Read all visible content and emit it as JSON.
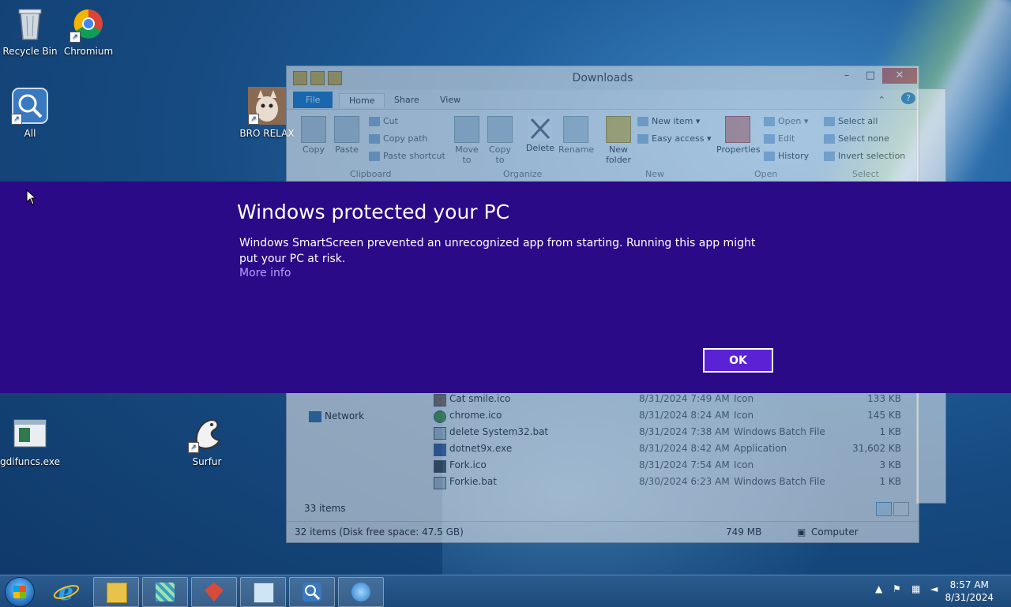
{
  "desktop": {
    "icons": [
      {
        "label": "Recycle Bin"
      },
      {
        "label": "Chromium"
      },
      {
        "label": "All"
      },
      {
        "label": "BRO RELAX"
      },
      {
        "label": "gdifuncs.exe"
      },
      {
        "label": "Surfur"
      }
    ]
  },
  "explorer": {
    "title": "Downloads",
    "tabs": [
      "File",
      "Home",
      "Share",
      "View"
    ],
    "ribbon": {
      "clipboard": {
        "copy": "Copy",
        "paste": "Paste",
        "cut": "Cut",
        "copy_path": "Copy path",
        "paste_shortcut": "Paste shortcut",
        "group": "Clipboard"
      },
      "organize": {
        "move_to": "Move to",
        "copy_to": "Copy to",
        "delete": "Delete",
        "rename": "Rename",
        "group": "Organize"
      },
      "new": {
        "new_folder": "New folder",
        "new_item": "New item",
        "easy_access": "Easy access",
        "group": "New"
      },
      "open": {
        "properties": "Properties",
        "open": "Open",
        "edit": "Edit",
        "history": "History",
        "group": "Open"
      },
      "select": {
        "select_all": "Select all",
        "select_none": "Select none",
        "invert": "Invert selection",
        "group": "Select"
      }
    },
    "nav_network": "Network",
    "files": [
      {
        "name": "Cat smile.ico",
        "date": "8/31/2024 7:49 AM",
        "type": "Icon",
        "size": "133 KB"
      },
      {
        "name": "chrome.ico",
        "date": "8/31/2024 8:24 AM",
        "type": "Icon",
        "size": "145 KB"
      },
      {
        "name": "delete System32.bat",
        "date": "8/31/2024 7:38 AM",
        "type": "Windows Batch File",
        "size": "1 KB"
      },
      {
        "name": "dotnet9x.exe",
        "date": "8/31/2024 8:42 AM",
        "type": "Application",
        "size": "31,602 KB"
      },
      {
        "name": "Fork.ico",
        "date": "8/31/2024 7:54 AM",
        "type": "Icon",
        "size": "3 KB"
      },
      {
        "name": "Forkie.bat",
        "date": "8/30/2024 6:23 AM",
        "type": "Windows Batch File",
        "size": "1 KB"
      }
    ],
    "item_count": "33 items",
    "status_left": "32 items (Disk free space: 47.5 GB)",
    "status_size": "749 MB",
    "status_location": "Computer"
  },
  "smartscreen": {
    "title": "Windows protected your PC",
    "message": "Windows SmartScreen prevented an unrecognized app from starting. Running this app might put your PC at risk.",
    "more_info": "More info",
    "ok": "OK"
  },
  "taskbar": {
    "time": "8:57 AM",
    "date": "8/31/2024"
  }
}
